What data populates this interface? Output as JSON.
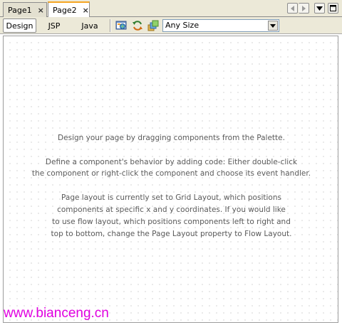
{
  "tabs": [
    {
      "label": "Page1",
      "close": "×",
      "active": false
    },
    {
      "label": "Page2",
      "close": "×",
      "active": true
    }
  ],
  "views": {
    "design": "Design",
    "jsp": "JSP",
    "java": "Java",
    "selected": "Design"
  },
  "toolbar_icons": [
    "preview-in-browser-icon",
    "refresh-icon",
    "show-virtual-forms-icon"
  ],
  "size_select": {
    "value": "Any Size"
  },
  "canvas": {
    "hint": {
      "line1": "Design your page by dragging components from the Palette.",
      "line2": "Define a component's behavior by adding code: Either double-click",
      "line3": "the component or right-click the component and choose its event handler.",
      "line4": "Page layout is currently set to Grid Layout, which positions",
      "line5": "components at specific x and y coordinates.  If you would like",
      "line6": "to use flow layout, which positions components left to right and",
      "line7": "top to bottom, change the Page Layout property to Flow Layout."
    }
  },
  "watermark": "www.bianceng.cn",
  "colors": {
    "active_tab_accent": "#f5a623",
    "watermark": "#e000e0",
    "hint_text": "#5a5a5a"
  }
}
